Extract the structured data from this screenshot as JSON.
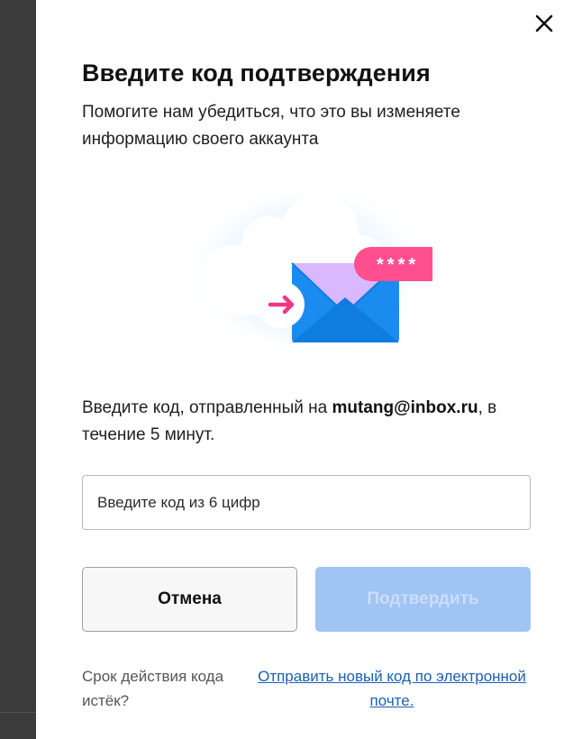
{
  "dialog": {
    "close_icon": "close-icon",
    "title": "Введите код подтверждения",
    "subtitle": "Помогите нам убедиться, что это вы изменяете информацию своего аккаунта",
    "illustration": {
      "icon": "envelope-illustration",
      "badge_text": "****",
      "colors": {
        "envelope": "#1a8cf0",
        "envelope_flap": "#d9b8ff",
        "badge": "#ff4f8f",
        "arrow": "#f0368a"
      }
    },
    "info_prefix": "Введите код, отправленный на ",
    "email": "mutang@inbox.ru",
    "info_suffix": ", в течение 5 минут.",
    "code_input": {
      "placeholder": "Введите код из 6 цифр",
      "value": ""
    },
    "cancel_label": "Отмена",
    "confirm_label": "Подтвердить",
    "expired_text": "Срок действия кода истёк?",
    "resend_link": "Отправить новый код по электронной почте."
  },
  "colors": {
    "confirm_disabled": "#a0c4f4",
    "link": "#1a5fb4"
  }
}
